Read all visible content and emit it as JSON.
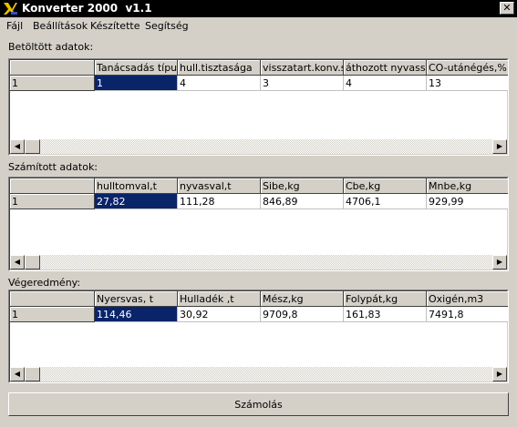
{
  "window": {
    "title": "Konverter 2000  v1.1",
    "close_symbol": "✕"
  },
  "menu": [
    "Fájl",
    "Beállítások",
    "Készítette",
    "Segítség"
  ],
  "sections": [
    {
      "label": "Betöltött adatok:",
      "headers": [
        "Tanácsadás típus",
        "hull.tisztasága",
        "visszatart.konv.sal",
        "áthozott nyvassal.t",
        "CO-utánégés,%"
      ],
      "row_label": "1",
      "values": [
        "1",
        "4",
        "3",
        "4",
        "13"
      ]
    },
    {
      "label": "Számított adatok:",
      "headers": [
        "hulltomval,t",
        "nyvasval,t",
        "Sibe,kg",
        "Cbe,kg",
        "Mnbe,kg"
      ],
      "row_label": "1",
      "values": [
        "27,82",
        "111,28",
        "846,89",
        "4706,1",
        "929,99"
      ]
    },
    {
      "label": "Végeredmény:",
      "headers": [
        "Nyersvas, t",
        "Hulladék ,t",
        "Mész,kg",
        "Folypát,kg",
        "Oxigén,m3"
      ],
      "row_label": "1",
      "values": [
        "114,46",
        "30,92",
        "9709,8",
        "161,83",
        "7491,8"
      ]
    }
  ],
  "scroll": {
    "left_arrow": "◀",
    "right_arrow": "▶"
  },
  "button": {
    "label": "Számolás"
  },
  "colors": {
    "selected": "#0a246a",
    "face": "#d4d0c8",
    "titlebar": "#000000"
  }
}
